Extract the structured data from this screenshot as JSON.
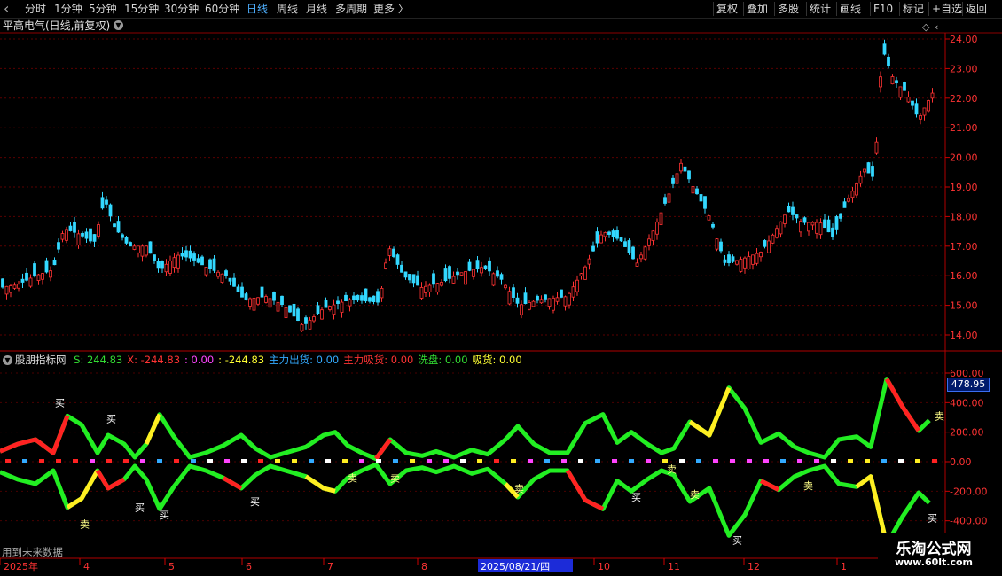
{
  "toolbar": {
    "left_items": [
      {
        "label": "分时",
        "active": false
      },
      {
        "label": "1分钟",
        "active": false
      },
      {
        "label": "5分钟",
        "active": false
      },
      {
        "label": "15分钟",
        "active": false
      },
      {
        "label": "30分钟",
        "active": false
      },
      {
        "label": "60分钟",
        "active": false
      },
      {
        "label": "日线",
        "active": true
      },
      {
        "label": "周线",
        "active": false
      },
      {
        "label": "月线",
        "active": false
      },
      {
        "label": "多周期",
        "active": false
      },
      {
        "label": "更多 〉",
        "active": false
      }
    ],
    "right_items": [
      "复权",
      "叠加",
      "多股",
      "统计",
      "画线",
      "F10",
      "标记",
      "+自选",
      "返回"
    ]
  },
  "main_chart": {
    "title": "平高电气(日线,前复权)",
    "y_ticks": [
      "24.00",
      "23.00",
      "22.00",
      "21.00",
      "20.00",
      "19.00",
      "18.00",
      "17.00",
      "16.00",
      "15.00",
      "14.00"
    ]
  },
  "indicator": {
    "name": "股朋指标网",
    "readouts": [
      {
        "label": "S:",
        "value": "244.83",
        "color": "#33dd33"
      },
      {
        "label": "X:",
        "value": "-244.83",
        "color": "#ff3333"
      },
      {
        "label": ":",
        "value": "0.00",
        "color": "#ff44ff"
      },
      {
        "label": ":",
        "value": "-244.83",
        "color": "#ffff33"
      },
      {
        "label": "主力出货:",
        "value": "0.00",
        "color": "#33aaff"
      },
      {
        "label": "主力吸货:",
        "value": "0.00",
        "color": "#ff3333"
      },
      {
        "label": "洗盘:",
        "value": "0.00",
        "color": "#33dd33"
      },
      {
        "label": "吸货:",
        "value": "0.00",
        "color": "#ffff33"
      }
    ],
    "y_ticks": [
      "600.00",
      "400.00",
      "200.00",
      "0.00",
      "-200.00",
      "-400.00"
    ],
    "cursor_value": "478.95",
    "signals": {
      "buy": "买",
      "sell": "卖"
    }
  },
  "footer": {
    "note": "用到未来数据",
    "date_axis": [
      "2025年",
      "4",
      "5",
      "6",
      "7",
      "8",
      "2025/08/21/四",
      "10",
      "11",
      "12",
      "1"
    ]
  },
  "watermark": {
    "title": "乐淘公式网",
    "url": "www.60lt.com"
  },
  "colors": {
    "up": "#ff3333",
    "down": "#33d8ff",
    "grid": "#8b0000",
    "axis_text": "#ff3333"
  }
}
